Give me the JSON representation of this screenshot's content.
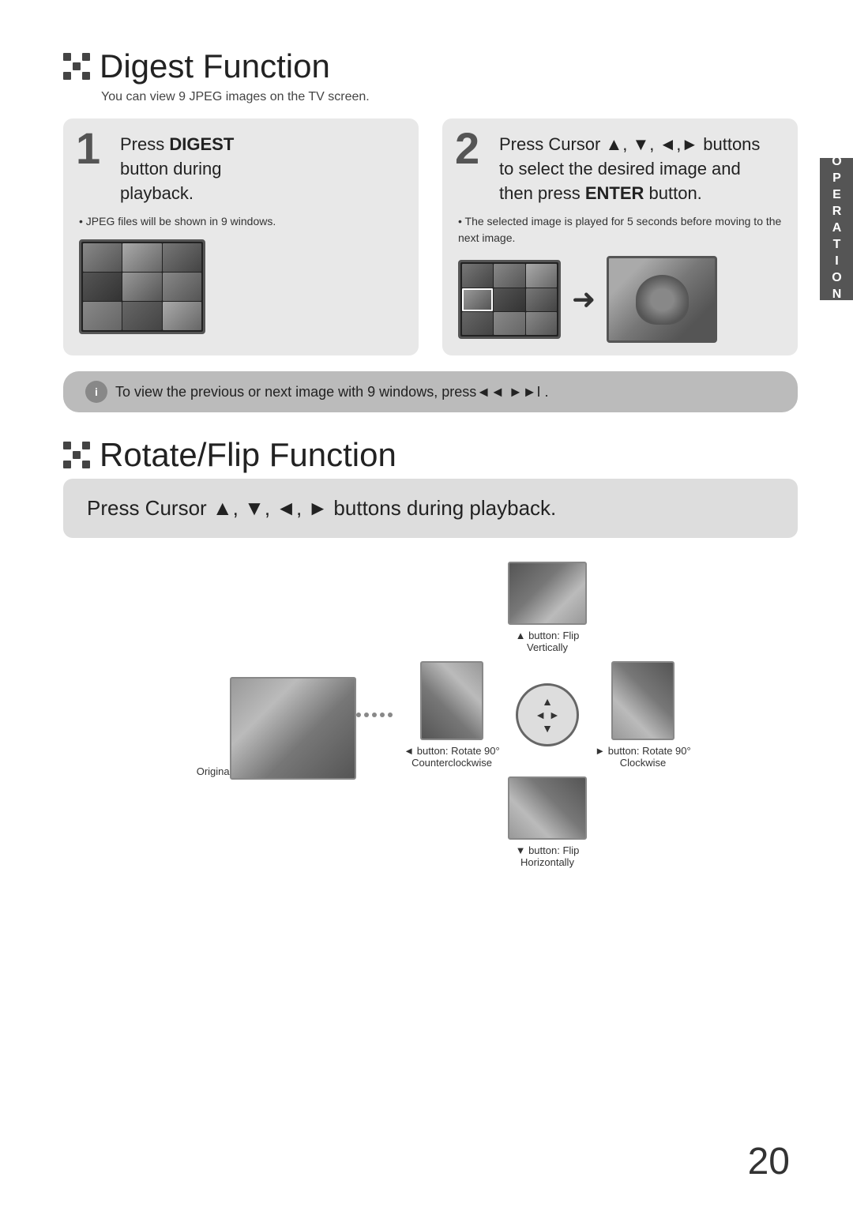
{
  "digest_section": {
    "title": "Digest Function",
    "subtitle": "You can view 9 JPEG images on the TV screen.",
    "step1": {
      "number": "1",
      "line1": "Press ",
      "bold1": "DIGEST",
      "line2": "button during",
      "line3": "playback.",
      "bullet": "JPEG files will be shown in 9 windows."
    },
    "step2": {
      "number": "2",
      "line1": "Press Cursor ▲, ▼, ◄,► buttons",
      "line2": "to select the desired image and",
      "line3": "then press ",
      "bold3": "ENTER",
      "line3b": " button.",
      "bullet": "The selected image is played for 5 seconds before moving to the next image."
    },
    "tip": "To view the previous or next image with 9 windows, press◄◄ ►►I  ."
  },
  "rotate_section": {
    "title": "Rotate/Flip Function",
    "press_cursor_label": "Press Cursor ▲, ▼, ◄, ►  buttons during playback.",
    "original_label": "Original Image",
    "up_label": "▲ button: Flip Vertically",
    "left_label": "◄ button: Rotate 90° Counterclockwise",
    "right_label": "► button: Rotate 90° Clockwise",
    "down_label": "▼ button: Flip Horizontally"
  },
  "page_number": "20",
  "sidebar_label": "OPERATION"
}
